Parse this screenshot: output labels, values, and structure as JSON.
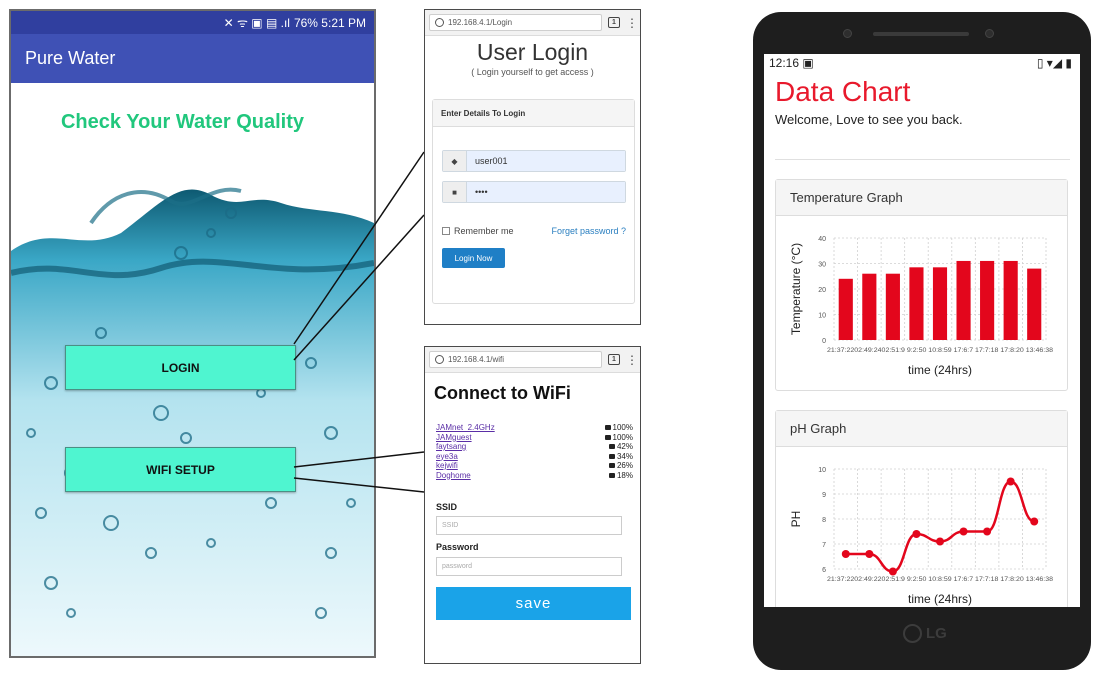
{
  "app": {
    "status_right": "76% 5:21 PM",
    "title": "Pure Water",
    "headline": "Check Your Water Quality",
    "login_button": "LOGIN",
    "wifi_button": "WIFI SETUP"
  },
  "login_page": {
    "url": "192.168.4.1/Login",
    "title": "User Login",
    "subtitle": "( Login yourself to get access )",
    "panel_heading": "Enter Details To Login",
    "username_value": "user001",
    "password_value": "••••",
    "remember_label": "Remember me",
    "forgot_link": "Forget password ?",
    "submit_label": "Login Now"
  },
  "wifi_page": {
    "url": "192.168.4.1/wifi",
    "title": "Connect to WiFi",
    "networks": [
      {
        "name": "JAMnet_2.4GHz",
        "signal": "100%"
      },
      {
        "name": "JAMguest",
        "signal": "100%"
      },
      {
        "name": "faytsang",
        "signal": "42%"
      },
      {
        "name": "eye3a",
        "signal": "34%"
      },
      {
        "name": "kejwifi",
        "signal": "26%"
      },
      {
        "name": "Doghome",
        "signal": "18%"
      }
    ],
    "ssid_label": "SSID",
    "ssid_placeholder": "SSID",
    "password_label": "Password",
    "password_placeholder": "password",
    "save_label": "save"
  },
  "data_chart_page": {
    "status_time": "12:16",
    "title": "Data Chart",
    "welcome": "Welcome, Love to see you back.",
    "device_brand": "LG"
  },
  "chart_data": [
    {
      "type": "bar",
      "title": "Temperature Graph",
      "xlabel": "time (24hrs)",
      "ylabel": "Temperature (°C)",
      "ylim": [
        0,
        40
      ],
      "yticks": [
        0,
        10,
        20,
        30,
        40
      ],
      "x_tick_text": "21:37:2202:49:2402:51:9 9:2:50 10:8:59 17:6:7 17:7:18 17:8:20 13:46:38",
      "values": [
        24,
        26,
        26,
        28.5,
        28.5,
        31,
        31,
        31,
        28
      ],
      "color": "#e3061c",
      "grid": true
    },
    {
      "type": "line",
      "title": "pH Graph",
      "xlabel": "time (24hrs)",
      "ylabel": "PH",
      "ylim": [
        6,
        10
      ],
      "yticks": [
        6,
        7,
        8,
        9,
        10
      ],
      "x_tick_text": "21:37:2202:49:2202:51:9 9:2:50 10:8:59 17:6:7 17:7:18 17:8:20 13:46:38",
      "values": [
        6.6,
        6.6,
        5.9,
        7.4,
        7.1,
        7.5,
        7.5,
        9.5,
        7.9
      ],
      "color": "#e3061c",
      "grid": true
    }
  ]
}
